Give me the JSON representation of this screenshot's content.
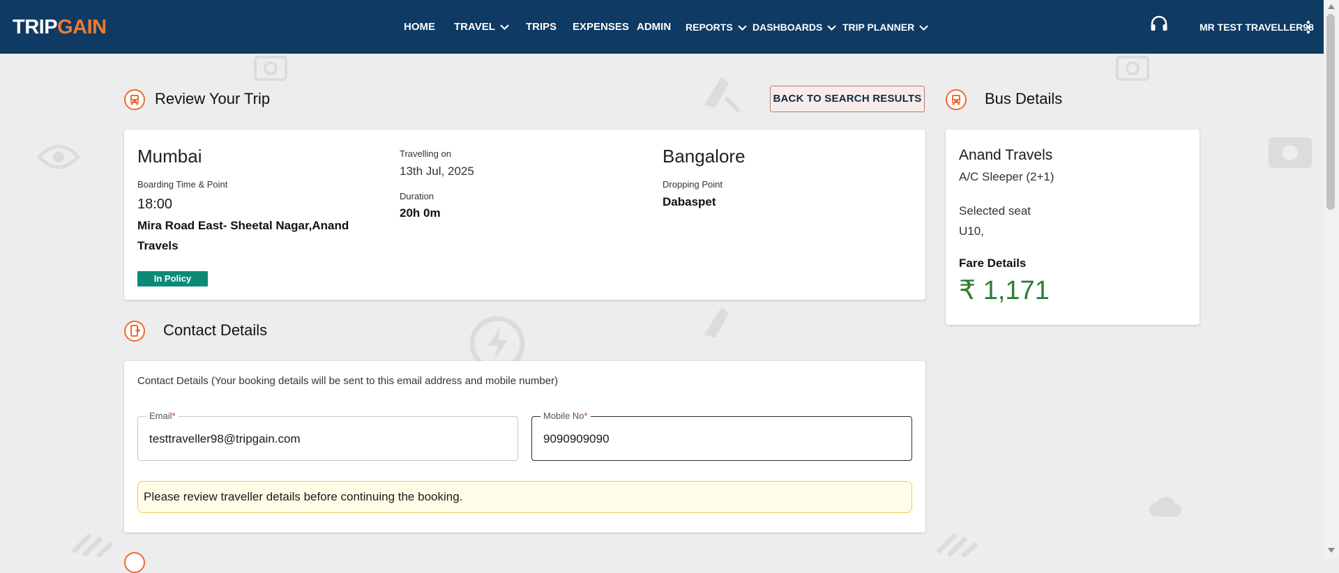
{
  "header": {
    "logo_part1": "TRIP",
    "logo_part2": "GAIN",
    "nav": [
      {
        "label": "HOME",
        "dropdown": false
      },
      {
        "label": "TRAVEL",
        "dropdown": true
      },
      {
        "label": "TRIPS",
        "dropdown": false
      },
      {
        "label": "EXPENSES",
        "dropdown": false
      },
      {
        "label": "ADMIN",
        "dropdown": false
      },
      {
        "label": "REPORTS",
        "dropdown": true
      },
      {
        "label": "DASHBOARDS",
        "dropdown": true
      },
      {
        "label": "TRIP PLANNER",
        "dropdown": true
      }
    ],
    "support_icon": "headset-icon",
    "user_name": "MR TEST TRAVELLER98",
    "menu_icon": "kebab-menu-icon"
  },
  "review": {
    "title": "Review Your Trip",
    "icon": "bus-icon",
    "back_button": "BACK TO SEARCH RESULTS",
    "origin": "Mumbai",
    "boarding_label": "Boarding Time & Point",
    "boarding_time": "18:00",
    "boarding_point_line1": "Mira Road East- Sheetal Nagar,Anand",
    "boarding_point_line2": "Travels",
    "policy_badge": "In Policy",
    "travelling_label": "Travelling on",
    "travel_date": "13th Jul, 2025",
    "duration_label": "Duration",
    "duration": "20h 0m",
    "destination": "Bangalore",
    "dropping_label": "Dropping Point",
    "dropping_point": "Dabaspet"
  },
  "bus": {
    "title": "Bus Details",
    "icon": "bus-icon",
    "operator": "Anand Travels",
    "bus_type": "A/C Sleeper (2+1)",
    "seat_label": "Selected seat",
    "seat": "U10,",
    "fare_label": "Fare Details",
    "fare": "₹ 1,171"
  },
  "contact": {
    "title": "Contact Details",
    "icon": "contact-phone-icon",
    "description": "Contact Details (Your booking details will be sent to this email address and mobile number)",
    "email_label": "Email",
    "email_value": "testtraveller98@tripgain.com",
    "mobile_label": "Mobile No",
    "mobile_value": "9090909090",
    "required_mark": "*",
    "notice": "Please review traveller details before continuing the booking."
  },
  "colors": {
    "header_bg": "#0e3a63",
    "accent_orange": "#ef6a2c",
    "policy_green": "#0d8a77",
    "fare_green": "#2e7d32",
    "notice_bg": "#fffde7"
  }
}
